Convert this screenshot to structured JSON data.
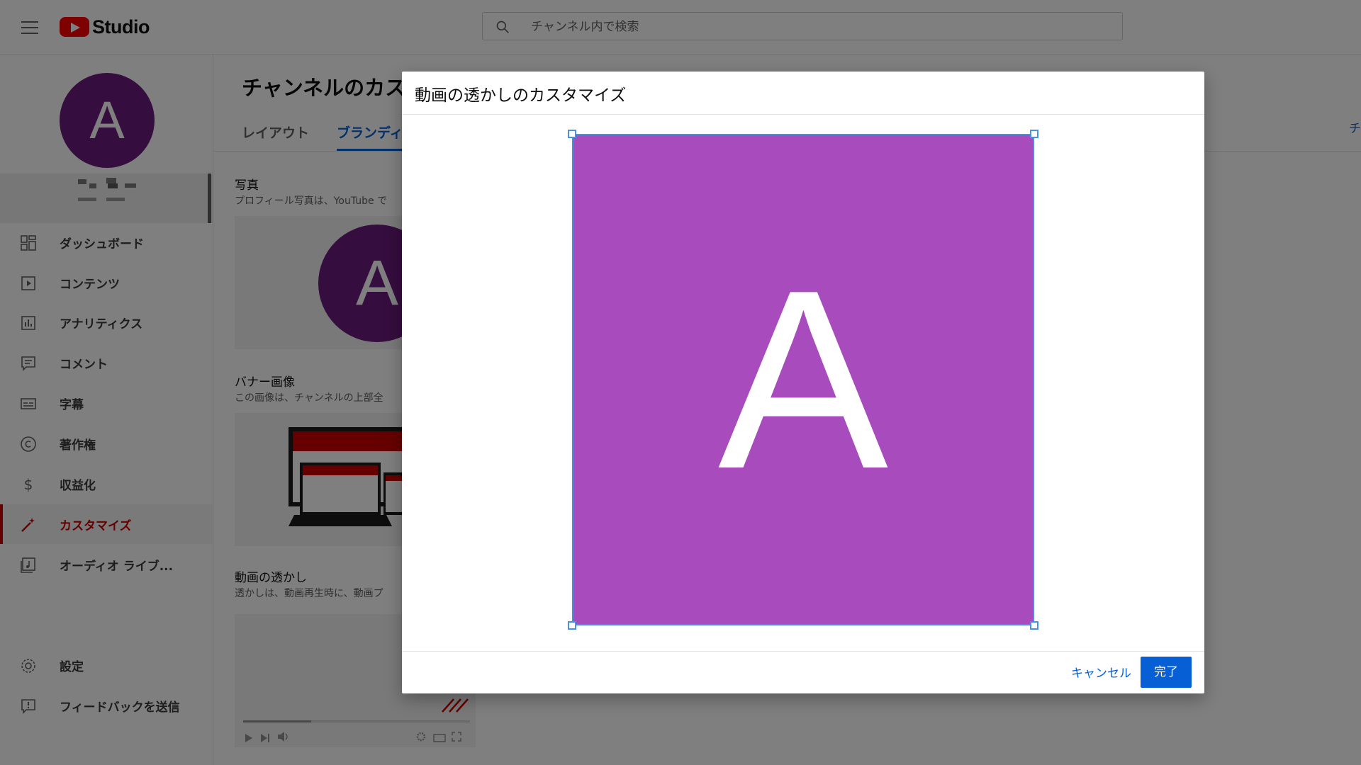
{
  "topbar": {
    "logo_text": "Studio",
    "search_placeholder": "チャンネル内で検索"
  },
  "channel": {
    "avatar_letter": "A"
  },
  "sidebar": {
    "items": [
      {
        "label": "ダッシュボード",
        "icon": "dashboard-icon"
      },
      {
        "label": "コンテンツ",
        "icon": "content-icon"
      },
      {
        "label": "アナリティクス",
        "icon": "analytics-icon"
      },
      {
        "label": "コメント",
        "icon": "comment-icon"
      },
      {
        "label": "字幕",
        "icon": "subtitles-icon"
      },
      {
        "label": "著作権",
        "icon": "copyright-icon"
      },
      {
        "label": "収益化",
        "icon": "dollar-icon"
      },
      {
        "label": "カスタマイズ",
        "icon": "magic-wand-icon",
        "active": true
      },
      {
        "label": "オーディオ ライブ...",
        "icon": "audio-library-icon"
      }
    ],
    "bottom": [
      {
        "label": "設定",
        "icon": "gear-icon"
      },
      {
        "label": "フィードバックを送信",
        "icon": "feedback-icon"
      }
    ],
    "accent_color": "#cc0000"
  },
  "page": {
    "title": "チャンネルのカス",
    "tabs": [
      {
        "label": "レイアウト"
      },
      {
        "label": "ブランディ",
        "active": true
      }
    ],
    "right_link": "チ",
    "sections": {
      "photo_title": "写真",
      "photo_desc": "プロフィール写真は、YouTube で",
      "banner_title": "バナー画像",
      "banner_desc": "この画像は、チャンネルの上部全",
      "watermark_title": "動画の透かし",
      "watermark_desc": "透かしは、動画再生時に、動画プ"
    }
  },
  "dialog": {
    "title": "動画の透かしのカスタマイズ",
    "image_letter": "A",
    "image_color": "#a84bbd",
    "crop_color": "#4a90e2",
    "cancel_label": "キャンセル",
    "done_label": "完了"
  }
}
